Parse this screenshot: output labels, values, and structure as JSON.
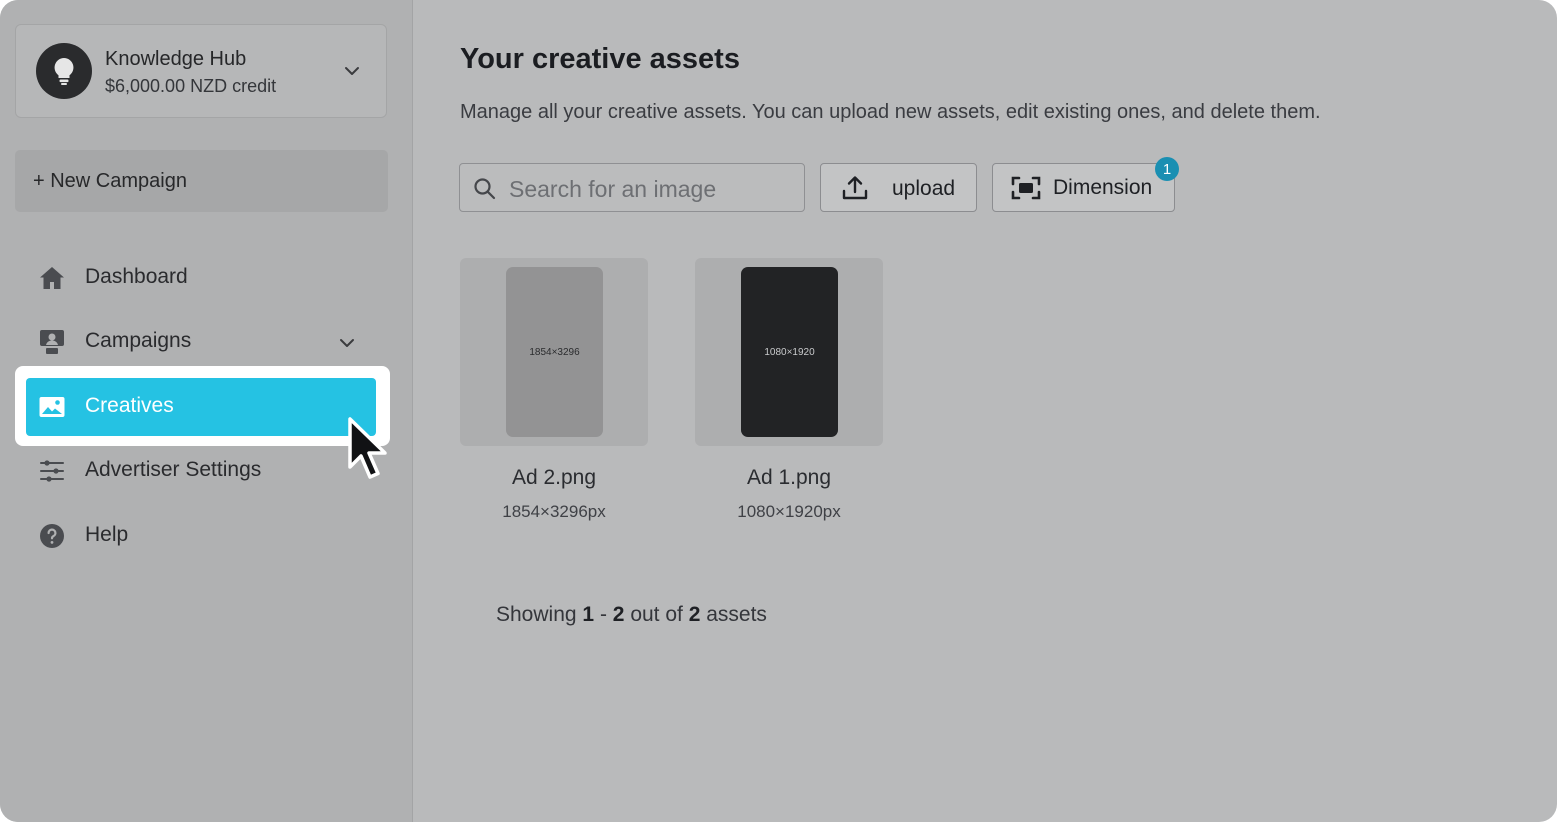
{
  "account": {
    "name": "Knowledge Hub",
    "credit": "$6,000.00 NZD credit"
  },
  "new_campaign_label": "+ New Campaign",
  "nav": {
    "dashboard": "Dashboard",
    "campaigns": "Campaigns",
    "creatives": "Creatives",
    "advertiser_settings": "Advertiser Settings",
    "help": "Help"
  },
  "main": {
    "title": "Your creative assets",
    "description": "Manage all your creative assets. You can upload new assets, edit existing ones, and delete them.",
    "search_placeholder": "Search for an image",
    "upload_label": "upload",
    "dimension_label": "Dimension",
    "dimension_badge": "1"
  },
  "assets": [
    {
      "name": "Ad 2.png",
      "thumb_label": "1854×3296",
      "dimensions": "1854×3296px",
      "thumb_color": "#939394",
      "thumb_text_color": "#2b2c2e"
    },
    {
      "name": "Ad 1.png",
      "thumb_label": "1080×1920",
      "dimensions": "1080×1920px",
      "thumb_color": "#222325",
      "thumb_text_color": "#c9cacc"
    }
  ],
  "summary": {
    "prefix": "Showing",
    "start": "1",
    "dash": "-",
    "end": "2",
    "middle": "out of",
    "total": "2",
    "suffix": "assets"
  },
  "colors": {
    "accent": "#25c2e3",
    "badge": "#1a8fb2",
    "overlay_bg": "#b9babb"
  }
}
